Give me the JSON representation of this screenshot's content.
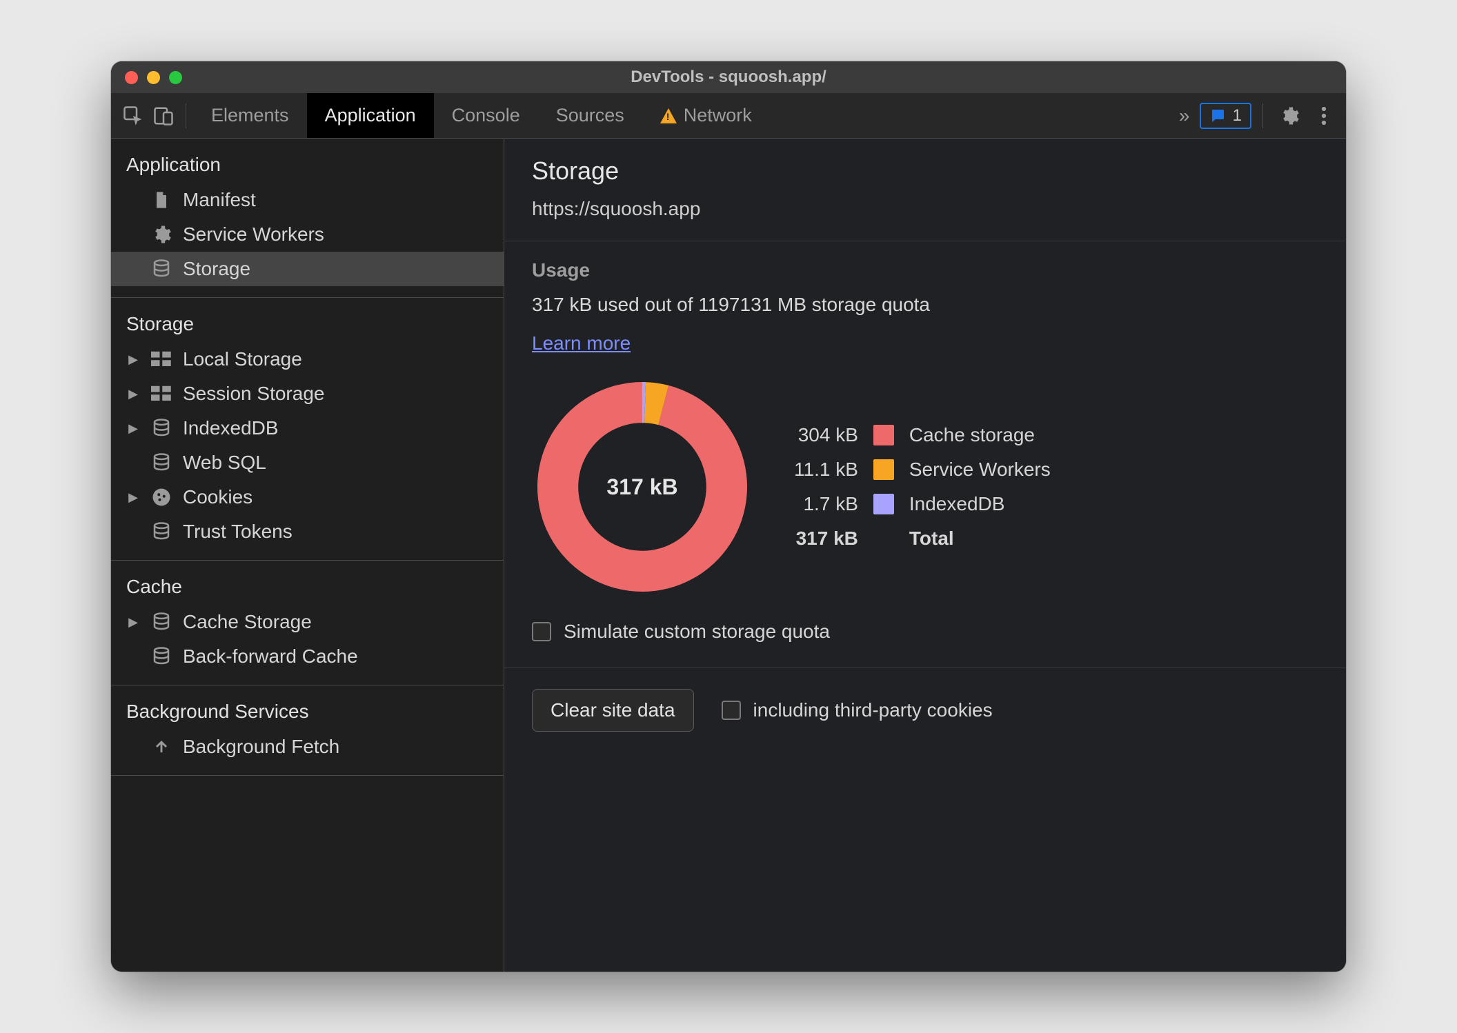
{
  "window": {
    "title": "DevTools - squoosh.app/"
  },
  "toolbar": {
    "tabs": [
      {
        "label": "Elements",
        "active": false,
        "warn": false
      },
      {
        "label": "Application",
        "active": true,
        "warn": false
      },
      {
        "label": "Console",
        "active": false,
        "warn": false
      },
      {
        "label": "Sources",
        "active": false,
        "warn": false
      },
      {
        "label": "Network",
        "active": false,
        "warn": true
      }
    ],
    "issues_count": "1"
  },
  "sidebar": {
    "sections": [
      {
        "heading": "Application",
        "items": [
          {
            "label": "Manifest",
            "icon": "file",
            "expandable": false,
            "selected": false
          },
          {
            "label": "Service Workers",
            "icon": "gear",
            "expandable": false,
            "selected": false
          },
          {
            "label": "Storage",
            "icon": "db",
            "expandable": false,
            "selected": true
          }
        ]
      },
      {
        "heading": "Storage",
        "items": [
          {
            "label": "Local Storage",
            "icon": "grid",
            "expandable": true,
            "selected": false
          },
          {
            "label": "Session Storage",
            "icon": "grid",
            "expandable": true,
            "selected": false
          },
          {
            "label": "IndexedDB",
            "icon": "db",
            "expandable": true,
            "selected": false
          },
          {
            "label": "Web SQL",
            "icon": "db",
            "expandable": false,
            "selected": false
          },
          {
            "label": "Cookies",
            "icon": "cookie",
            "expandable": true,
            "selected": false
          },
          {
            "label": "Trust Tokens",
            "icon": "db",
            "expandable": false,
            "selected": false
          }
        ]
      },
      {
        "heading": "Cache",
        "items": [
          {
            "label": "Cache Storage",
            "icon": "db",
            "expandable": true,
            "selected": false
          },
          {
            "label": "Back-forward Cache",
            "icon": "db",
            "expandable": false,
            "selected": false
          }
        ]
      },
      {
        "heading": "Background Services",
        "items": [
          {
            "label": "Background Fetch",
            "icon": "upload",
            "expandable": false,
            "selected": false
          }
        ]
      }
    ]
  },
  "main": {
    "title": "Storage",
    "origin": "https://squoosh.app",
    "usage_heading": "Usage",
    "usage_line": "317 kB used out of 1197131 MB storage quota",
    "learn_more": "Learn more",
    "center_label": "317 kB",
    "simulate_label": "Simulate custom storage quota",
    "clear_button": "Clear site data",
    "third_party_label": "including third-party cookies",
    "legend": [
      {
        "value": "304 kB",
        "label": "Cache storage",
        "color": "#ee6a6a"
      },
      {
        "value": "11.1 kB",
        "label": "Service Workers",
        "color": "#f6a623"
      },
      {
        "value": "1.7 kB",
        "label": "IndexedDB",
        "color": "#a7a3ff"
      },
      {
        "value": "317 kB",
        "label": "Total",
        "color": ""
      }
    ]
  },
  "chart_data": {
    "type": "pie",
    "title": "Storage usage",
    "series": [
      {
        "name": "Cache storage",
        "value_kb": 304,
        "color": "#ee6a6a"
      },
      {
        "name": "Service Workers",
        "value_kb": 11.1,
        "color": "#f6a623"
      },
      {
        "name": "IndexedDB",
        "value_kb": 1.7,
        "color": "#a7a3ff"
      }
    ],
    "total_label": "317 kB",
    "total_kb": 317,
    "quota": "1197131 MB"
  }
}
